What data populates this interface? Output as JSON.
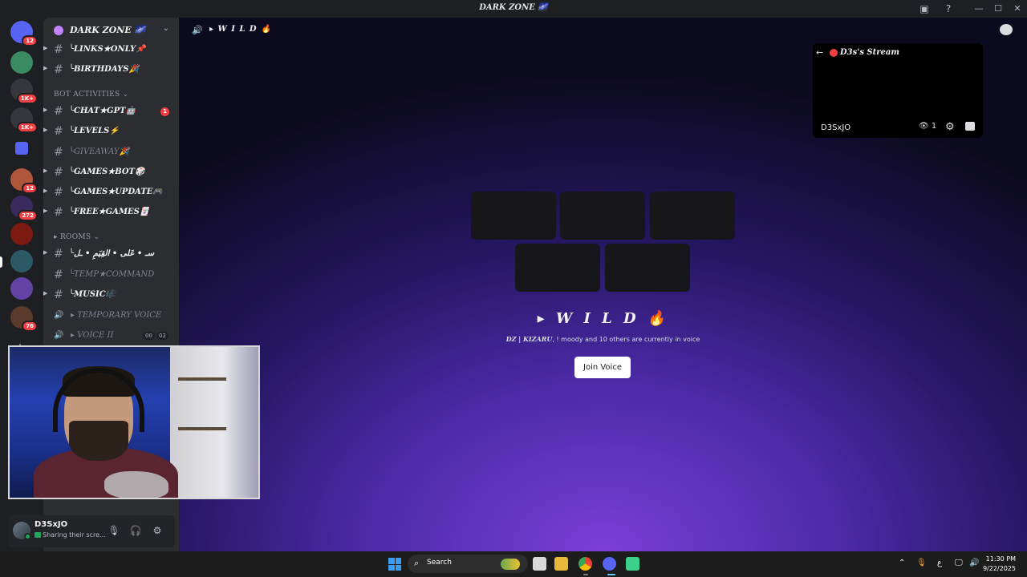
{
  "window": {
    "title": "DARK ZONE 🌌"
  },
  "server": {
    "name": "DARK ZONE 🌌"
  },
  "rail_badges": [
    "12",
    "1K+",
    "1K+",
    "12",
    "272",
    "76"
  ],
  "channels": [
    {
      "label": "╰LINKS★ONLY📌",
      "type": "text"
    },
    {
      "label": "╰BIRTHDAYS🎉",
      "type": "text"
    }
  ],
  "categories": {
    "bot": "BOT ACTIVITIES ⌄",
    "rooms": "▸ ROOMS ⌄"
  },
  "bot_channels": [
    {
      "label": "╰CHAT★GPT🤖",
      "unread": "1"
    },
    {
      "label": "╰LEVELS⚡"
    },
    {
      "label": "╰GIVEAWAY🎉",
      "muted": true
    },
    {
      "label": "╰GAMES★BOT🎲"
    },
    {
      "label": "╰GAMES★UPDATE🎮"
    },
    {
      "label": "╰FREE★GAMES🃏"
    }
  ],
  "room_channels": [
    {
      "label": "╰سـ • عَلى • القِيَمِ • ـل"
    },
    {
      "label": "╰TEMP★COMMAND",
      "muted": true
    },
    {
      "label": "╰MUSIC🎼"
    }
  ],
  "voice_channels": [
    {
      "label": "▸ TEMPORARY VOICE"
    },
    {
      "label": "▸ VOICE II",
      "count_a": "00",
      "count_b": "02"
    }
  ],
  "user": {
    "name": "D3SxJO",
    "status": "Sharing their scre..."
  },
  "main": {
    "channel": "▸ W I L D 🔥",
    "voice_title": "▸ W I L D 🔥",
    "voice_sub_bold": "DZ | KIZARU",
    "voice_sub_rest": ", ! moody and 10 others are currently in voice",
    "join_label": "Join Voice"
  },
  "stream": {
    "title": "D3s's Stream",
    "streamer": "D3SxJO",
    "viewers": "1"
  },
  "taskbar": {
    "search": "Search",
    "time": "11:30 PM",
    "date": "9/22/2025",
    "lang": "ع"
  }
}
